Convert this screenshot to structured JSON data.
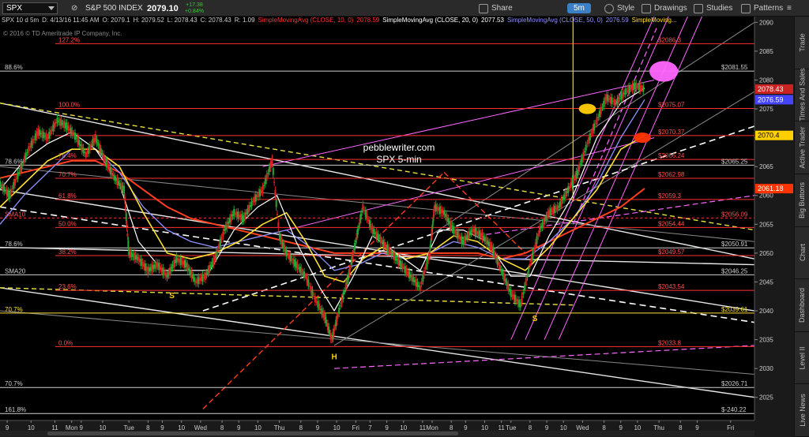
{
  "toolbar": {
    "symbol": "SPX",
    "index_name": "S&P 500 INDEX",
    "last_price": "2079.10",
    "change_abs": "+17.38",
    "change_pct": "+0.84%",
    "timeframe": "5m",
    "share": "Share",
    "style": "Style",
    "drawings": "Drawings",
    "studies": "Studies",
    "patterns": "Patterns"
  },
  "info": {
    "symbol_period": "SPX 10 d 5m",
    "datetime": "D: 4/13/16 11:45 AM",
    "open": "O: 2079.1",
    "high": "H: 2079.52",
    "low": "L: 2078.43",
    "close": "C: 2078.43",
    "range": "R: 1.09",
    "sma10": "SimpleMovingAvg (CLOSE, 10, 0)",
    "sma10_val": "2078.59",
    "sma20": "SimpleMovingAvg (CLOSE, 20, 0)",
    "sma20_val": "2077.53",
    "sma50": "SimpleMovingAvg (CLOSE, 50, 0)",
    "sma50_val": "2076.59",
    "sma_more": "SimpleMoving...",
    "copyright": "© 2016 © TD Ameritrade IP Company, Inc."
  },
  "side_tabs": [
    "Trade",
    "Times And Sales",
    "Active Trader",
    "Big Buttons",
    "Chart",
    "Dashboard",
    "Level II",
    "Live News"
  ],
  "colors": {
    "bg": "#000000",
    "fib": "#ff3030",
    "price_up": "#22aa33",
    "price_down": "#dd2222",
    "sma10": "#ffffff",
    "sma20": "#ffe033",
    "sma50": "#9090ff",
    "sma_long": "#ff4020",
    "channel": "#ff66ff"
  },
  "chart_data": {
    "type": "line",
    "title": "pebblewriter.com",
    "subtitle": "SPX 5-min",
    "ylim": [
      2021,
      2091
    ],
    "y_ticks": [
      2090,
      2085,
      2080,
      2075,
      2070,
      2065,
      2060,
      2055,
      2050,
      2045,
      2040,
      2035,
      2030,
      2025
    ],
    "x_axis": [
      {
        "label": "9",
        "x": 0.3
      },
      {
        "label": "10",
        "x": 1.3
      },
      {
        "label": "11",
        "x": 2.3
      },
      {
        "label": "Mon",
        "x": 3.0
      },
      {
        "label": "9",
        "x": 3.4
      },
      {
        "label": "10",
        "x": 4.3
      },
      {
        "label": "Tue",
        "x": 5.4
      },
      {
        "label": "8",
        "x": 6.2
      },
      {
        "label": "9",
        "x": 6.8
      },
      {
        "label": "10",
        "x": 7.6
      },
      {
        "label": "Wed",
        "x": 8.4
      },
      {
        "label": "8",
        "x": 9.3
      },
      {
        "label": "9",
        "x": 10.0
      },
      {
        "label": "10",
        "x": 10.8
      },
      {
        "label": "Thu",
        "x": 11.7
      },
      {
        "label": "8",
        "x": 12.6
      },
      {
        "label": "9",
        "x": 13.3
      },
      {
        "label": "10",
        "x": 14.1
      },
      {
        "label": "Fri",
        "x": 14.9
      },
      {
        "label": "7",
        "x": 15.5
      },
      {
        "label": "9",
        "x": 16.2
      },
      {
        "label": "10",
        "x": 16.9
      },
      {
        "label": "11",
        "x": 17.7
      },
      {
        "label": "Mon",
        "x": 18.1
      },
      {
        "label": "8",
        "x": 18.9
      },
      {
        "label": "9",
        "x": 19.5
      },
      {
        "label": "10",
        "x": 20.3
      },
      {
        "label": "11",
        "x": 21.0
      },
      {
        "label": "Tue",
        "x": 21.4
      },
      {
        "label": "8",
        "x": 22.2
      },
      {
        "label": "9",
        "x": 22.9
      },
      {
        "label": "10",
        "x": 23.6
      },
      {
        "label": "Wed",
        "x": 24.4
      },
      {
        "label": "8",
        "x": 25.3
      },
      {
        "label": "9",
        "x": 26.0
      },
      {
        "label": "10",
        "x": 26.7
      },
      {
        "label": "Thu",
        "x": 27.6
      },
      {
        "label": "8",
        "x": 28.5
      },
      {
        "label": "9",
        "x": 29.2
      },
      {
        "label": "Fri",
        "x": 30.6
      }
    ],
    "xlim": [
      0,
      31.6
    ],
    "fib_levels": [
      {
        "label": "127.2%",
        "y": 2086.3,
        "value_label": "$2086.3"
      },
      {
        "label": "100.0%",
        "y": 2075.07,
        "value_label": "$2075.07"
      },
      {
        "label": "",
        "y": 2070.37,
        "value_label": "$2070.37"
      },
      {
        "label": "76.4%",
        "y": 2066.24,
        "value_label": "$2066.24"
      },
      {
        "label": "70.7%",
        "y": 2062.98,
        "value_label": "$2062.98"
      },
      {
        "label": "61.8%",
        "y": 2059.3,
        "value_label": "$2059.3"
      },
      {
        "label": "50.0%",
        "y": 2054.44,
        "value_label": "$2054.44"
      },
      {
        "label": "38.2%",
        "y": 2049.57,
        "value_label": "$2049.57"
      },
      {
        "label": "23.6%",
        "y": 2043.54,
        "value_label": "$2043.54"
      },
      {
        "label": "0.0%",
        "y": 2033.8,
        "value_label": "$2033.8"
      }
    ],
    "white_levels": [
      {
        "label": "88.6%",
        "y": 2081.55,
        "value_label": "$2081.55"
      },
      {
        "label": "78.6%",
        "y": 2065.25,
        "value_label": "$2065.25"
      },
      {
        "label": "78.6%",
        "y": 2050.91,
        "value_label": "$2050.91"
      },
      {
        "label": "SMA20",
        "y": 2046.25,
        "value_label": "$2046.25"
      },
      {
        "label": "70.7%",
        "y": 2039.61,
        "value_label": "$2039.61",
        "color": "#ffe033"
      },
      {
        "label": "70.7%",
        "y": 2026.71,
        "value_label": "$2026.71"
      },
      {
        "label": "161.8%",
        "y": 2022.2,
        "value_label": "$-240.22"
      }
    ],
    "sma10_level": {
      "label": "SMA10",
      "y": 2056.09,
      "value_label": "$2056.09"
    },
    "price_badges": [
      {
        "value": "2078.43",
        "y": 2078.43,
        "bg": "#cc2222"
      },
      {
        "value": "2076.59",
        "y": 2076.59,
        "bg": "#4444ff"
      },
      {
        "value": "2070.4",
        "y": 2070.4,
        "bg": "#ffd000",
        "fg": "#000"
      },
      {
        "value": "2061.18",
        "y": 2061.18,
        "bg": "#ff3300"
      }
    ],
    "price": [
      [
        0.0,
        2062
      ],
      [
        0.4,
        2060
      ],
      [
        0.8,
        2064
      ],
      [
        1.2,
        2068
      ],
      [
        1.6,
        2071
      ],
      [
        2.0,
        2070
      ],
      [
        2.4,
        2073
      ],
      [
        2.8,
        2072
      ],
      [
        3.2,
        2070
      ],
      [
        3.6,
        2067
      ],
      [
        4.0,
        2070
      ],
      [
        4.4,
        2066
      ],
      [
        4.8,
        2063
      ],
      [
        5.2,
        2061
      ],
      [
        5.4,
        2050
      ],
      [
        5.8,
        2049
      ],
      [
        6.2,
        2047
      ],
      [
        6.6,
        2048
      ],
      [
        7.0,
        2046
      ],
      [
        7.4,
        2049
      ],
      [
        7.8,
        2048
      ],
      [
        8.2,
        2045
      ],
      [
        8.6,
        2046
      ],
      [
        9.0,
        2049
      ],
      [
        9.4,
        2054
      ],
      [
        9.8,
        2057
      ],
      [
        10.2,
        2056
      ],
      [
        10.6,
        2059
      ],
      [
        11.0,
        2061
      ],
      [
        11.4,
        2066
      ],
      [
        11.7,
        2053
      ],
      [
        12.0,
        2050
      ],
      [
        12.4,
        2048
      ],
      [
        12.8,
        2046
      ],
      [
        13.2,
        2042
      ],
      [
        13.6,
        2039
      ],
      [
        13.9,
        2035
      ],
      [
        14.2,
        2040
      ],
      [
        14.6,
        2046
      ],
      [
        14.9,
        2052
      ],
      [
        15.2,
        2058
      ],
      [
        15.6,
        2054
      ],
      [
        16.0,
        2052
      ],
      [
        16.4,
        2050
      ],
      [
        16.8,
        2048
      ],
      [
        17.2,
        2046
      ],
      [
        17.6,
        2044
      ],
      [
        18.0,
        2050
      ],
      [
        18.2,
        2058
      ],
      [
        18.6,
        2057
      ],
      [
        19.0,
        2054
      ],
      [
        19.4,
        2052
      ],
      [
        19.8,
        2054
      ],
      [
        20.2,
        2053
      ],
      [
        20.6,
        2051
      ],
      [
        21.0,
        2047
      ],
      [
        21.4,
        2043
      ],
      [
        21.8,
        2041
      ],
      [
        22.2,
        2048
      ],
      [
        22.6,
        2054
      ],
      [
        23.0,
        2057
      ],
      [
        23.4,
        2058
      ],
      [
        23.8,
        2061
      ],
      [
        24.2,
        2064
      ],
      [
        24.6,
        2069
      ],
      [
        25.0,
        2073
      ],
      [
        25.4,
        2077
      ],
      [
        25.8,
        2076
      ],
      [
        26.2,
        2078
      ],
      [
        26.6,
        2079
      ],
      [
        27.0,
        2078.4
      ]
    ],
    "sma10": [
      [
        0.0,
        2061
      ],
      [
        1.0,
        2066
      ],
      [
        2.0,
        2069
      ],
      [
        3.0,
        2071
      ],
      [
        4.0,
        2068
      ],
      [
        5.0,
        2062
      ],
      [
        5.8,
        2052
      ],
      [
        6.8,
        2047
      ],
      [
        7.8,
        2047
      ],
      [
        8.8,
        2047
      ],
      [
        9.8,
        2054
      ],
      [
        10.8,
        2058
      ],
      [
        11.6,
        2060
      ],
      [
        12.4,
        2052
      ],
      [
        13.4,
        2044
      ],
      [
        14.0,
        2040
      ],
      [
        14.8,
        2046
      ],
      [
        15.6,
        2053
      ],
      [
        16.6,
        2050
      ],
      [
        17.6,
        2047
      ],
      [
        18.4,
        2054
      ],
      [
        19.4,
        2054
      ],
      [
        20.4,
        2052
      ],
      [
        21.4,
        2046
      ],
      [
        22.2,
        2046
      ],
      [
        23.0,
        2053
      ],
      [
        24.0,
        2060
      ],
      [
        25.0,
        2070
      ],
      [
        26.0,
        2076
      ],
      [
        27.0,
        2078.6
      ]
    ],
    "sma20": [
      [
        0.0,
        2058
      ],
      [
        1.0,
        2062
      ],
      [
        2.0,
        2066
      ],
      [
        3.0,
        2068
      ],
      [
        4.0,
        2068
      ],
      [
        5.0,
        2065
      ],
      [
        6.0,
        2057
      ],
      [
        7.0,
        2050
      ],
      [
        8.0,
        2049
      ],
      [
        9.0,
        2050
      ],
      [
        10.0,
        2052
      ],
      [
        11.0,
        2055
      ],
      [
        12.0,
        2057
      ],
      [
        12.8,
        2052
      ],
      [
        13.6,
        2046
      ],
      [
        14.4,
        2045
      ],
      [
        15.2,
        2049
      ],
      [
        16.0,
        2051
      ],
      [
        17.0,
        2049
      ],
      [
        18.0,
        2050
      ],
      [
        19.0,
        2053
      ],
      [
        20.0,
        2052
      ],
      [
        21.0,
        2049
      ],
      [
        22.0,
        2047
      ],
      [
        23.0,
        2051
      ],
      [
        24.0,
        2056
      ],
      [
        25.0,
        2061
      ],
      [
        26.0,
        2068
      ],
      [
        27.0,
        2070.4
      ]
    ],
    "sma50": [
      [
        0.0,
        2055
      ],
      [
        1.0,
        2060
      ],
      [
        2.0,
        2064
      ],
      [
        3.0,
        2068
      ],
      [
        4.0,
        2068
      ],
      [
        5.0,
        2064
      ],
      [
        6.0,
        2058
      ],
      [
        7.0,
        2054
      ],
      [
        8.0,
        2052
      ],
      [
        9.0,
        2051
      ],
      [
        10.0,
        2052
      ],
      [
        11.0,
        2053
      ],
      [
        12.0,
        2054
      ],
      [
        13.0,
        2051
      ],
      [
        14.0,
        2047
      ],
      [
        15.0,
        2048
      ],
      [
        16.0,
        2050
      ],
      [
        17.0,
        2049
      ],
      [
        18.0,
        2050
      ],
      [
        19.0,
        2052
      ],
      [
        20.0,
        2051
      ],
      [
        21.0,
        2049
      ],
      [
        22.0,
        2049
      ],
      [
        23.0,
        2052
      ],
      [
        24.0,
        2056
      ],
      [
        25.0,
        2062
      ],
      [
        26.0,
        2070
      ],
      [
        27.0,
        2076.6
      ]
    ],
    "sma_long": [
      [
        0.0,
        2063
      ],
      [
        1.0,
        2064
      ],
      [
        2.0,
        2065
      ],
      [
        3.0,
        2066
      ],
      [
        4.0,
        2066
      ],
      [
        5.0,
        2064
      ],
      [
        6.0,
        2061
      ],
      [
        7.0,
        2058
      ],
      [
        8.0,
        2056
      ],
      [
        9.0,
        2055
      ],
      [
        10.0,
        2054
      ],
      [
        11.0,
        2053
      ],
      [
        12.0,
        2052
      ],
      [
        13.0,
        2051
      ],
      [
        14.0,
        2050
      ],
      [
        15.0,
        2050
      ],
      [
        16.0,
        2050
      ],
      [
        17.0,
        2050
      ],
      [
        18.0,
        2050
      ],
      [
        19.0,
        2050
      ],
      [
        20.0,
        2050
      ],
      [
        21.0,
        2049
      ],
      [
        22.0,
        2050
      ],
      [
        23.0,
        2052
      ],
      [
        24.0,
        2054
      ],
      [
        25.0,
        2056
      ],
      [
        26.0,
        2058
      ],
      [
        27.0,
        2061.2
      ]
    ],
    "trendlines": [
      {
        "kind": "white",
        "pts": [
          [
            0,
            2076
          ],
          [
            31.6,
            2049
          ]
        ]
      },
      {
        "kind": "white",
        "pts": [
          [
            0,
            2061
          ],
          [
            31.6,
            2040
          ]
        ]
      },
      {
        "kind": "white",
        "pts": [
          [
            0,
            2051
          ],
          [
            31.6,
            2048
          ]
        ]
      },
      {
        "kind": "white",
        "pts": [
          [
            0,
            2044
          ],
          [
            31.6,
            2025
          ]
        ]
      },
      {
        "kind": "gray",
        "pts": [
          [
            0,
            2065
          ],
          [
            31.6,
            2052
          ]
        ]
      },
      {
        "kind": "gray",
        "pts": [
          [
            0,
            2040
          ],
          [
            31.6,
            2029
          ]
        ]
      },
      {
        "kind": "gray",
        "pts": [
          [
            14,
            2034
          ],
          [
            31.6,
            2078
          ]
        ]
      },
      {
        "kind": "gray",
        "pts": [
          [
            18,
            2053
          ],
          [
            31.6,
            2090
          ]
        ]
      },
      {
        "kind": "white-dash",
        "pts": [
          [
            0,
            2058
          ],
          [
            31.6,
            2038
          ]
        ]
      },
      {
        "kind": "white-dash",
        "pts": [
          [
            8.5,
            2040
          ],
          [
            31.6,
            2072
          ]
        ]
      },
      {
        "kind": "yellow-dash",
        "pts": [
          [
            0,
            2076
          ],
          [
            31.6,
            2054
          ]
        ]
      },
      {
        "kind": "yellow-dash",
        "pts": [
          [
            0,
            2044
          ],
          [
            24,
            2041
          ]
        ]
      },
      {
        "kind": "red-dash",
        "pts": [
          [
            8.5,
            2023
          ],
          [
            18.6,
            2064
          ]
        ]
      },
      {
        "kind": "red-dash",
        "pts": [
          [
            18.6,
            2064
          ],
          [
            22,
            2050
          ]
        ]
      },
      {
        "kind": "pink",
        "pts": [
          [
            11,
            2065
          ],
          [
            27.4,
            2080
          ]
        ]
      },
      {
        "kind": "pink",
        "pts": [
          [
            12,
            2054
          ],
          [
            27.4,
            2070
          ]
        ]
      },
      {
        "kind": "pink-dash",
        "pts": [
          [
            14,
            2030
          ],
          [
            31.6,
            2034
          ]
        ]
      },
      {
        "kind": "pink-dash",
        "pts": [
          [
            20,
            2053
          ],
          [
            31.6,
            2060
          ]
        ]
      },
      {
        "kind": "pink",
        "pts": [
          [
            21.4,
            2035
          ],
          [
            27.4,
            2091
          ]
        ]
      },
      {
        "kind": "pink",
        "pts": [
          [
            22.0,
            2035
          ],
          [
            28.0,
            2091
          ]
        ]
      },
      {
        "kind": "pink",
        "pts": [
          [
            22.8,
            2035
          ],
          [
            28.8,
            2091
          ]
        ]
      },
      {
        "kind": "pink",
        "pts": [
          [
            23.4,
            2035
          ],
          [
            29.4,
            2091
          ]
        ]
      },
      {
        "kind": "pink-dash",
        "pts": [
          [
            24,
            2055
          ],
          [
            27.5,
            2089
          ]
        ]
      }
    ],
    "annotations": [
      {
        "text": "S",
        "x": 7.2,
        "y": 2042.2,
        "color": "#ffd000"
      },
      {
        "text": "S",
        "x": 22.4,
        "y": 2038.2,
        "color": "#ffd000"
      },
      {
        "text": "H",
        "x": 14.0,
        "y": 2031.6,
        "color": "#ffd000"
      }
    ],
    "vertical_marker": {
      "x": 24.0,
      "y_from": 2059,
      "y_to": 2091,
      "color": "#ffd000"
    },
    "ellipses": [
      {
        "x": 27.8,
        "y": 2081.5,
        "color": "#ff66ff",
        "rx": 1.0,
        "ry": 1.2
      },
      {
        "x": 26.9,
        "y": 2070.0,
        "color": "#ff3300",
        "rx": 0.6,
        "ry": 0.6
      },
      {
        "x": 24.6,
        "y": 2075.0,
        "color": "#ffd000",
        "rx": 0.6,
        "ry": 0.6
      }
    ]
  }
}
